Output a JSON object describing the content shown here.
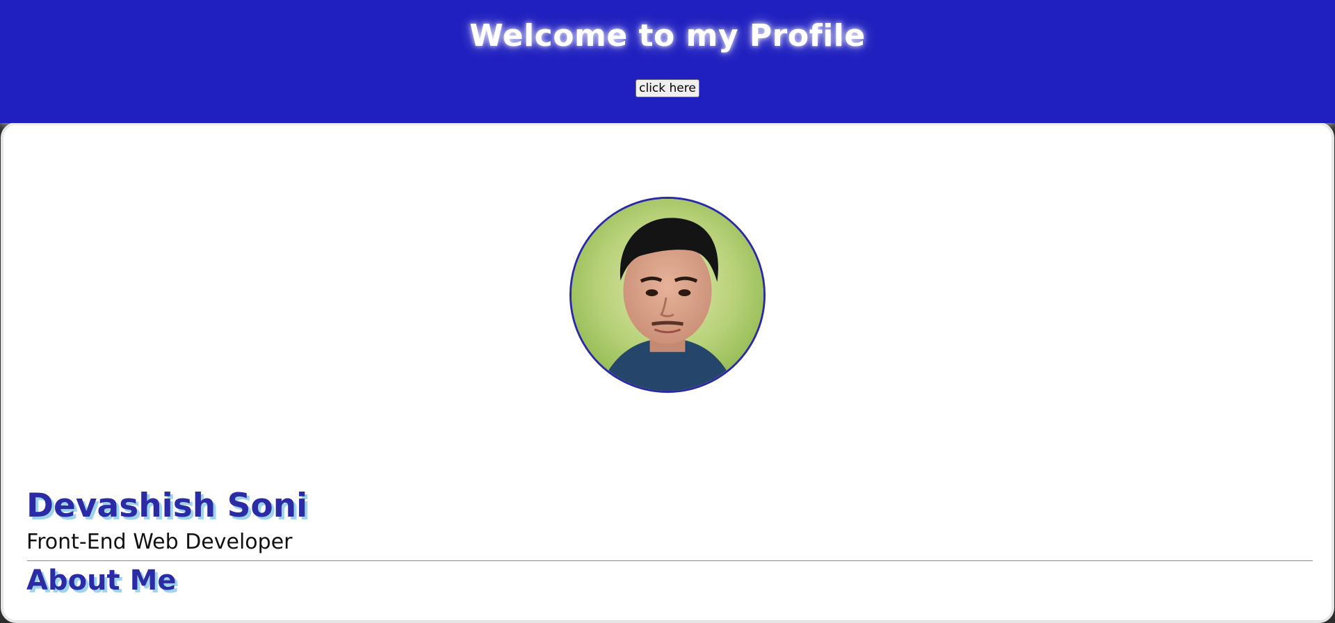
{
  "header": {
    "title": "Welcome to my Profile",
    "button_label": "click here"
  },
  "profile": {
    "name": "Devashish Soni",
    "role": "Front-End Web Developer",
    "about_heading": "About Me",
    "about_text": ""
  },
  "colors": {
    "header_bg": "#2020c0",
    "heading": "#2b2ba5",
    "heading_shadow": "#9ed3ec"
  }
}
